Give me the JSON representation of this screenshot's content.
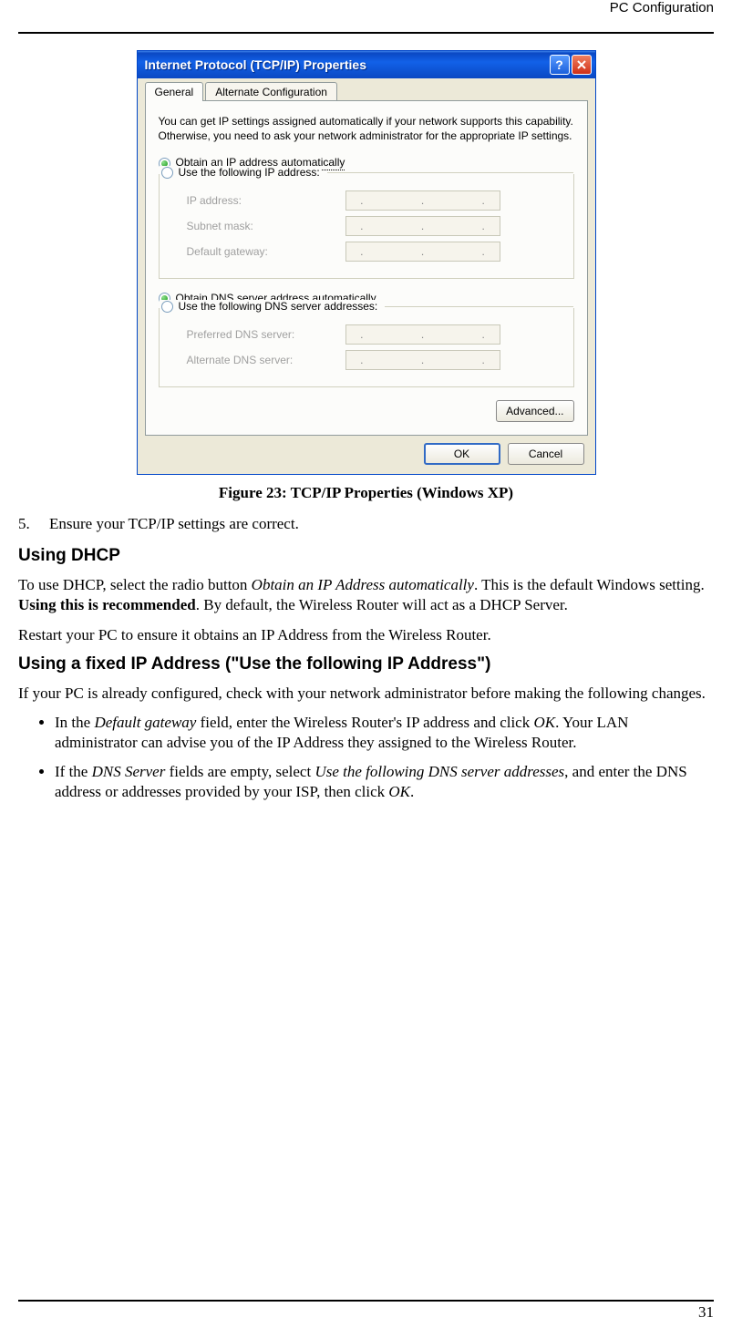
{
  "header": {
    "section": "PC Configuration"
  },
  "page_number": "31",
  "dialog": {
    "title": "Internet Protocol (TCP/IP) Properties",
    "tabs": {
      "general": "General",
      "alternate": "Alternate Configuration"
    },
    "description": "You can get IP settings assigned automatically if your network supports this capability. Otherwise, you need to ask your network administrator for the appropriate IP settings.",
    "radios": {
      "obtain_ip": "Obtain an IP address automatically",
      "use_ip": "Use the following IP address:",
      "obtain_dns": "Obtain DNS server address automatically",
      "use_dns": "Use the following DNS server addresses:"
    },
    "fields": {
      "ip_address": "IP address:",
      "subnet_mask": "Subnet mask:",
      "default_gateway": "Default gateway:",
      "pref_dns": "Preferred DNS server:",
      "alt_dns": "Alternate DNS server:"
    },
    "buttons": {
      "advanced": "Advanced...",
      "ok": "OK",
      "cancel": "Cancel"
    }
  },
  "caption": "Figure 23: TCP/IP Properties (Windows XP)",
  "step5": {
    "num": "5.",
    "text": "Ensure your TCP/IP settings are correct."
  },
  "dhcp": {
    "heading": "Using DHCP",
    "p1a": "To use DHCP, select the radio button ",
    "p1_ital": "Obtain an IP Address automatically",
    "p1b": ". This is the default Windows setting. ",
    "p1_bold": "Using this is recommended",
    "p1c": ". By default, the Wireless Router will act as a DHCP Server.",
    "p2": "Restart your PC to ensure it obtains an IP Address from the Wireless Router."
  },
  "fixed": {
    "heading": "Using a fixed IP Address (\"Use the following IP Address\")",
    "p1": "If your PC is already configured, check with your network administrator before making the following changes.",
    "b1a": "In the ",
    "b1_ital1": "Default gateway",
    "b1b": " field, enter the Wireless Router's IP address and click ",
    "b1_ital2": "OK",
    "b1c": ". Your LAN administrator can advise you of the IP Address they assigned to the Wireless Router.",
    "b2a": "If the ",
    "b2_ital1": "DNS Server",
    "b2b": " fields are empty, select ",
    "b2_ital2": "Use the following DNS server addresses",
    "b2c": ", and enter the DNS address or addresses provided by your ISP, then click ",
    "b2_ital3": "OK",
    "b2d": "."
  }
}
